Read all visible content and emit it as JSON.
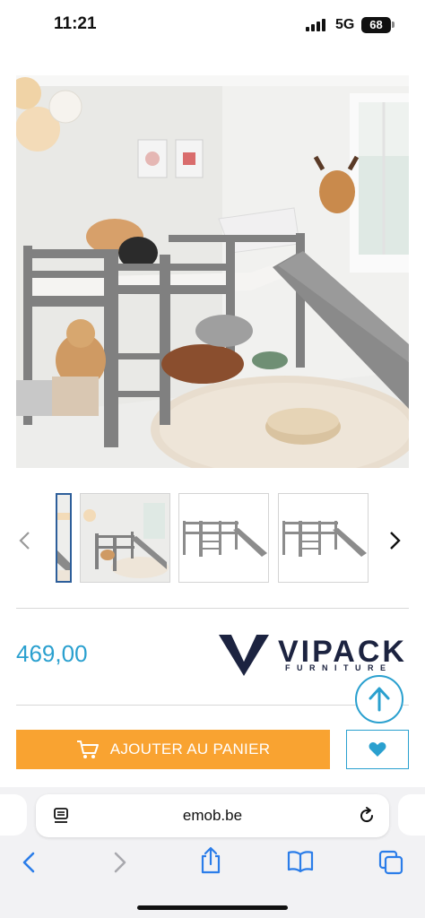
{
  "status_bar": {
    "time": "11:21",
    "network": "5G",
    "battery": "68"
  },
  "gallery": {
    "main_image_icon": "loft-bed-with-slide-photo",
    "thumbnails": [
      {
        "icon": "bed-photo-cropped-thumb",
        "active": true
      },
      {
        "icon": "bed-room-photo-thumb",
        "active": false
      },
      {
        "icon": "bed-side-view-thumb",
        "active": false
      },
      {
        "icon": "bed-side-view-thumb",
        "active": false
      }
    ],
    "prev_icon": "chevron-left-icon",
    "next_icon": "chevron-right-icon"
  },
  "product": {
    "price": "469,00",
    "brand_name": "VIPACK",
    "brand_sub": "FURNITURE"
  },
  "actions": {
    "add_to_cart": "AJOUTER AU PANIER",
    "wishlist_icon": "heart-icon",
    "scroll_top_icon": "arrow-up-icon"
  },
  "browser": {
    "url": "emob.be",
    "toolbar": [
      "back-icon",
      "forward-icon",
      "share-icon",
      "bookmarks-icon",
      "tabs-icon"
    ]
  },
  "colors": {
    "accent": "#2aa0cf",
    "cart_button": "#f9a331",
    "brand": "#1c2340"
  }
}
